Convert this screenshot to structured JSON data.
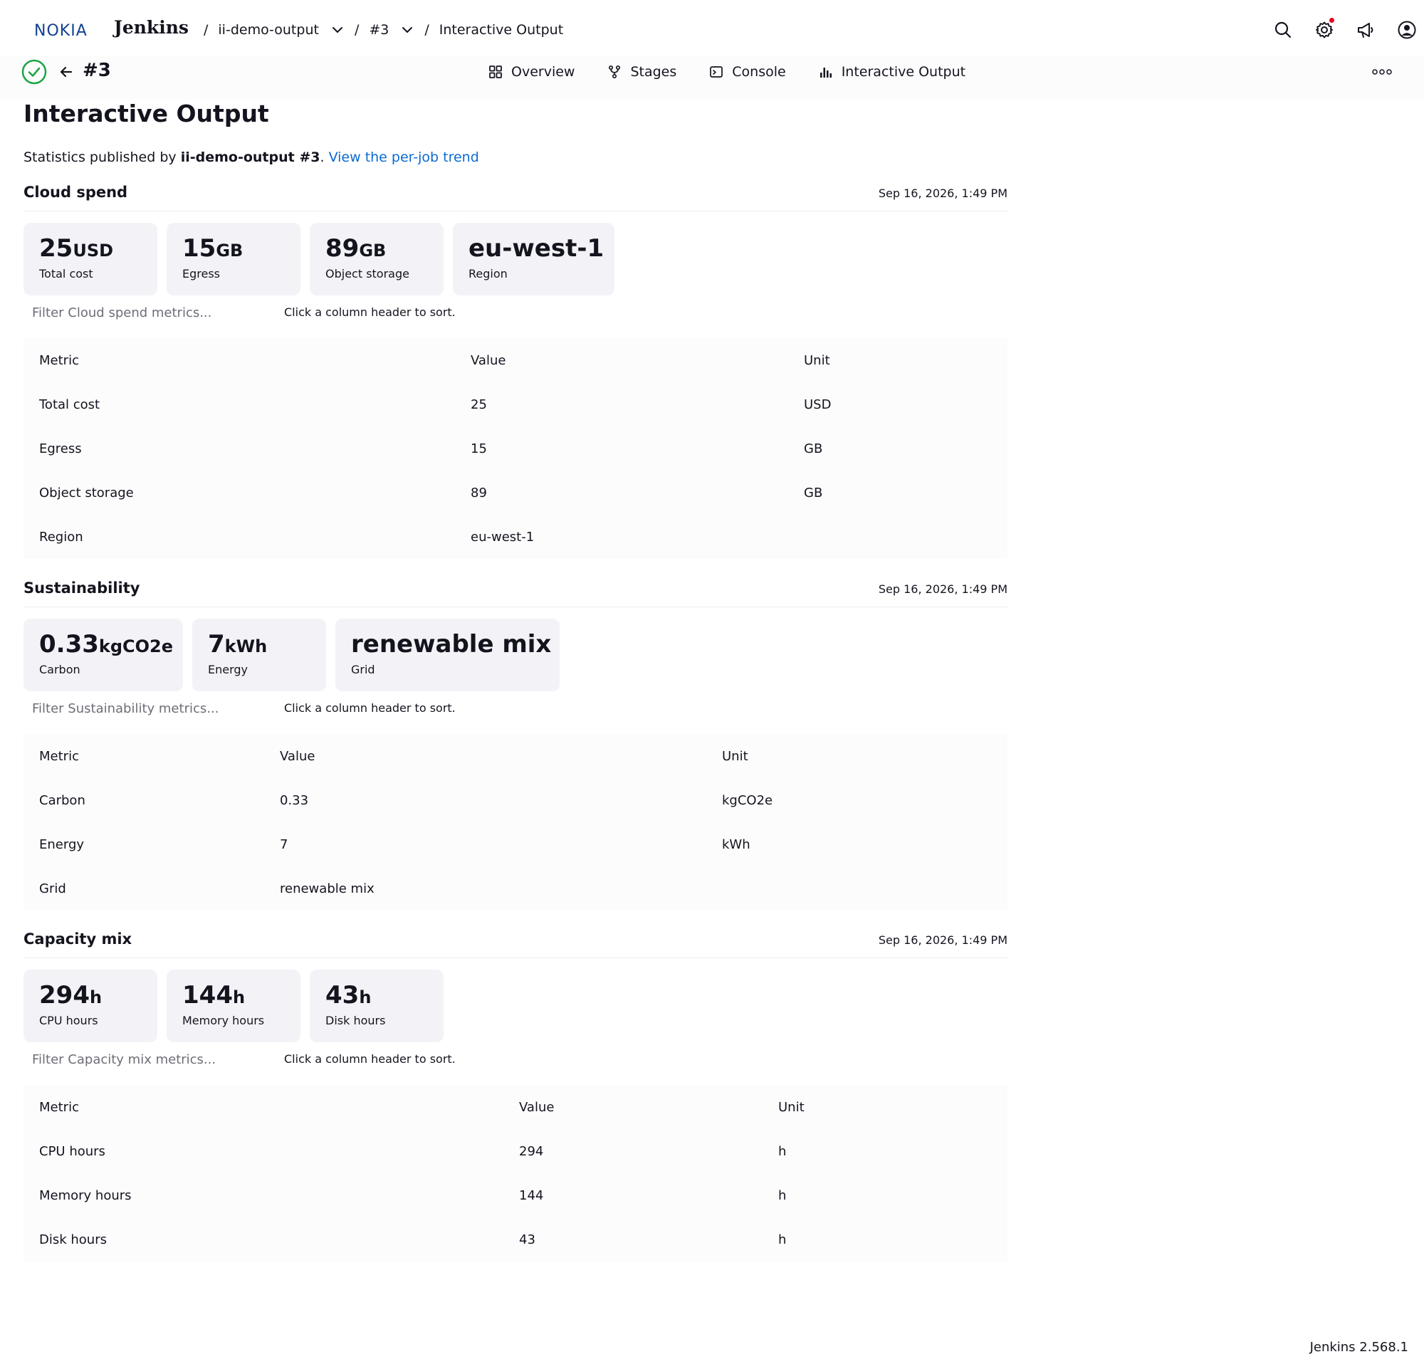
{
  "brand": {
    "name": "Jenkins",
    "logo_text": "NOKIA"
  },
  "breadcrumb": {
    "job": "ii-demo-output",
    "build": "#3",
    "page": "Interactive Output",
    "separator": "/"
  },
  "app_bar": {
    "build_number": "#3",
    "tabs": [
      {
        "label": "Overview",
        "icon": "grid-icon"
      },
      {
        "label": "Stages",
        "icon": "branch-icon"
      },
      {
        "label": "Console",
        "icon": "terminal-icon"
      },
      {
        "label": "Interactive Output",
        "icon": "bar-chart-icon"
      }
    ]
  },
  "page": {
    "title": "Interactive Output",
    "intro_prefix": "Statistics published by ",
    "intro_job": "ii-demo-output #3",
    "intro_period": ". ",
    "intro_link": "View the per-job trend"
  },
  "sections": [
    {
      "title": "Cloud spend",
      "date": "Sep 16, 2026, 1:49 PM",
      "filter_placeholder": "Filter Cloud spend metrics...",
      "sort_hint": "Click a column header to sort.",
      "cards": [
        {
          "value": "25",
          "unit": "USD",
          "label": "Total cost"
        },
        {
          "value": "15",
          "unit": "GB",
          "label": "Egress"
        },
        {
          "value": "89",
          "unit": "GB",
          "label": "Object storage"
        },
        {
          "value": "eu-west-1",
          "unit": "",
          "label": "Region"
        }
      ],
      "columns": [
        "Metric",
        "Value",
        "Unit"
      ],
      "rows": [
        [
          "Total cost",
          "25",
          "USD"
        ],
        [
          "Egress",
          "15",
          "GB"
        ],
        [
          "Object storage",
          "89",
          "GB"
        ],
        [
          "Region",
          "eu-west-1",
          ""
        ]
      ]
    },
    {
      "title": "Sustainability",
      "date": "Sep 16, 2026, 1:49 PM",
      "filter_placeholder": "Filter Sustainability metrics...",
      "sort_hint": "Click a column header to sort.",
      "cards": [
        {
          "value": "0.33",
          "unit": "kgCO2e",
          "label": "Carbon"
        },
        {
          "value": "7",
          "unit": "kWh",
          "label": "Energy"
        },
        {
          "value": "renewable mix",
          "unit": "",
          "label": "Grid"
        }
      ],
      "columns": [
        "Metric",
        "Value",
        "Unit"
      ],
      "rows": [
        [
          "Carbon",
          "0.33",
          "kgCO2e"
        ],
        [
          "Energy",
          "7",
          "kWh"
        ],
        [
          "Grid",
          "renewable mix",
          ""
        ]
      ]
    },
    {
      "title": "Capacity mix",
      "date": "Sep 16, 2026, 1:49 PM",
      "filter_placeholder": "Filter Capacity mix metrics...",
      "sort_hint": "Click a column header to sort.",
      "cards": [
        {
          "value": "294",
          "unit": "h",
          "label": "CPU hours"
        },
        {
          "value": "144",
          "unit": "h",
          "label": "Memory hours"
        },
        {
          "value": "43",
          "unit": "h",
          "label": "Disk hours"
        }
      ],
      "columns": [
        "Metric",
        "Value",
        "Unit"
      ],
      "rows": [
        [
          "CPU hours",
          "294",
          "h"
        ],
        [
          "Memory hours",
          "144",
          "h"
        ],
        [
          "Disk hours",
          "43",
          "h"
        ]
      ]
    }
  ],
  "footer": {
    "version": "Jenkins 2.568.1"
  },
  "colors": {
    "accent": "#0b6ad1",
    "success": "#1ea446",
    "card_bg": "#f3f3f7",
    "logo": "#124191",
    "notification": "#e6001c"
  }
}
